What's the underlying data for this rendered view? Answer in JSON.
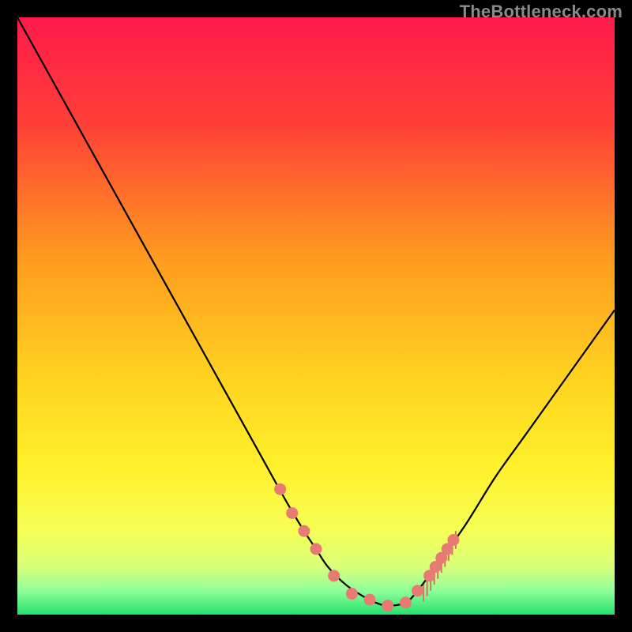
{
  "watermark": "TheBottleneck.com",
  "chart_data": {
    "type": "line",
    "title": "",
    "xlabel": "",
    "ylabel": "",
    "xlim": [
      0,
      100
    ],
    "ylim": [
      0,
      100
    ],
    "grid": false,
    "series": [
      {
        "name": "bottleneck-curve",
        "x": [
          0,
          5,
          10,
          15,
          20,
          25,
          30,
          35,
          40,
          45,
          48,
          50,
          52,
          55,
          58,
          60,
          62,
          65,
          67,
          70,
          75,
          80,
          85,
          90,
          95,
          100
        ],
        "y": [
          100,
          91,
          82,
          73,
          64,
          55,
          46,
          37,
          28,
          19,
          14,
          11,
          8,
          5,
          3,
          2,
          1.5,
          2,
          4,
          8,
          15,
          23,
          30,
          37,
          44,
          51
        ]
      }
    ],
    "markers": {
      "name": "highlight-dots",
      "color": "#e77b73",
      "x": [
        44,
        46,
        48,
        50,
        53,
        56,
        59,
        62,
        65,
        67,
        69,
        70,
        71,
        72,
        73
      ],
      "y": [
        21,
        17,
        14,
        11,
        6.5,
        3.5,
        2.5,
        1.5,
        2,
        4,
        6.5,
        8,
        9.5,
        11,
        12.5
      ]
    },
    "ticks": {
      "name": "bristles",
      "x": [
        68,
        68.6,
        69.2,
        69.8,
        70.4,
        71,
        71.6,
        72.2,
        72.8,
        73.4
      ],
      "y0": [
        5.2,
        6.1,
        7.0,
        8.0,
        9.0,
        10.0,
        11.0,
        12.0,
        13.0,
        14.0
      ],
      "dy": [
        3,
        3,
        3,
        3,
        3,
        3,
        3,
        3,
        3,
        3
      ]
    },
    "gradient_stops": [
      {
        "offset": 0,
        "color": "#ff1a4b"
      },
      {
        "offset": 0.18,
        "color": "#ff4036"
      },
      {
        "offset": 0.4,
        "color": "#ff9a1f"
      },
      {
        "offset": 0.6,
        "color": "#ffd21f"
      },
      {
        "offset": 0.75,
        "color": "#fff02a"
      },
      {
        "offset": 0.86,
        "color": "#f6ff55"
      },
      {
        "offset": 0.92,
        "color": "#d8ff7a"
      },
      {
        "offset": 0.96,
        "color": "#8fff9a"
      },
      {
        "offset": 1.0,
        "color": "#24e06e"
      }
    ]
  }
}
